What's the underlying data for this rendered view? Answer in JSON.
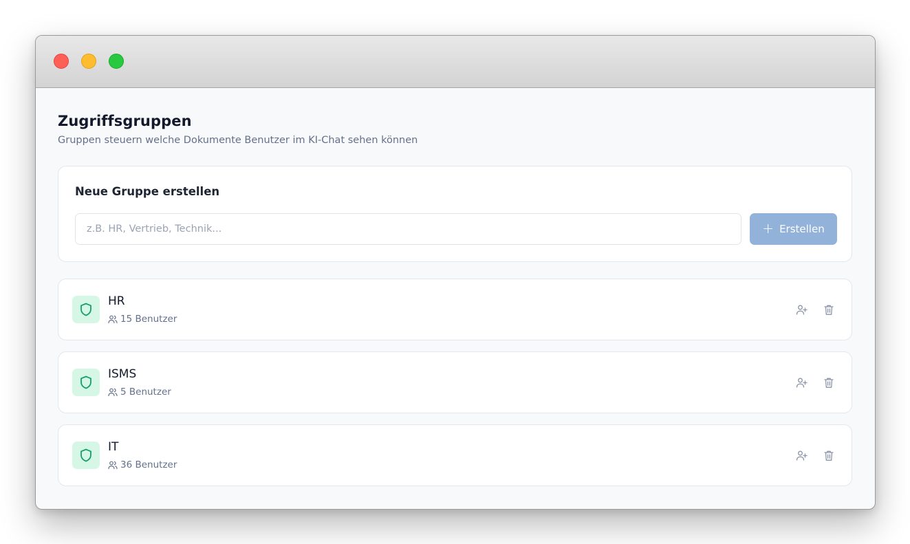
{
  "page": {
    "title": "Zugriffsgruppen",
    "subtitle": "Gruppen steuern welche Dokumente Benutzer im KI-Chat sehen können"
  },
  "create": {
    "title": "Neue Gruppe erstellen",
    "placeholder": "z.B. HR, Vertrieb, Technik...",
    "button_label": "Erstellen",
    "button_icon": "plus-icon"
  },
  "groups": [
    {
      "name": "HR",
      "members": "15 Benutzer"
    },
    {
      "name": "ISMS",
      "members": "5 Benutzer"
    },
    {
      "name": "IT",
      "members": "36 Benutzer"
    }
  ],
  "colors": {
    "accent_button": "#93b2da",
    "shield_bg": "#d7f7e6",
    "shield_stroke": "#12a067",
    "title_text": "#121a2c",
    "muted_text": "#64708a"
  }
}
